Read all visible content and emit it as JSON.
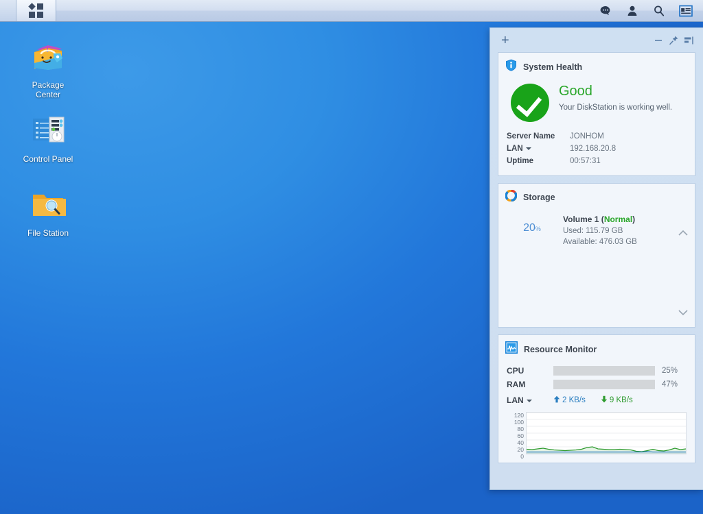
{
  "taskbar": {
    "main_menu_icon": "app-grid-icon",
    "tray": [
      {
        "name": "notifications-icon",
        "glyph": "speech-bubble"
      },
      {
        "name": "user-icon",
        "glyph": "person"
      },
      {
        "name": "search-icon",
        "glyph": "magnifier"
      },
      {
        "name": "widget-toggle-icon",
        "glyph": "widget-card"
      }
    ]
  },
  "desktop": {
    "icons": [
      {
        "name": "package-center",
        "label_line1": "Package",
        "label_line2": "Center"
      },
      {
        "name": "control-panel",
        "label_line1": "Control Panel",
        "label_line2": ""
      },
      {
        "name": "file-station",
        "label_line1": "File Station",
        "label_line2": ""
      }
    ]
  },
  "widget_panel": {
    "add_label": "+",
    "controls": [
      {
        "name": "minimize-widgets-button",
        "glyph": "minus"
      },
      {
        "name": "pin-widgets-button",
        "glyph": "pushpin"
      },
      {
        "name": "dock-widgets-button",
        "glyph": "dock-right"
      }
    ],
    "system_health": {
      "title": "System Health",
      "icon": "shield-info-icon",
      "status": "Good",
      "description": "Your DiskStation is working well.",
      "status_color": "#2aa62a",
      "rows": [
        {
          "key": "Server Name",
          "value": "JONHOM",
          "has_caret": false
        },
        {
          "key": "LAN",
          "value": "192.168.20.8",
          "has_caret": true
        },
        {
          "key": "Uptime",
          "value": "00:57:31",
          "has_caret": false
        }
      ]
    },
    "storage": {
      "title": "Storage",
      "icon": "storage-donut-icon",
      "percent": 20,
      "percent_label": "20",
      "percent_sign": "%",
      "volume_name": "Volume 1",
      "volume_status": "Normal",
      "used_label": "Used: 115.79 GB",
      "available_label": "Available: 476.03 GB",
      "arc_color": "#2a8fe0",
      "track_color": "#d6dade"
    },
    "resource_monitor": {
      "title": "Resource Monitor",
      "icon": "resource-monitor-icon",
      "bars": [
        {
          "label": "CPU",
          "percent": 25,
          "percent_label": "25%"
        },
        {
          "label": "RAM",
          "percent": 47,
          "percent_label": "47%"
        }
      ],
      "lan_label": "LAN",
      "upload_label": "2 KB/s",
      "download_label": "9 KB/s",
      "chart_data": {
        "type": "line",
        "title": "",
        "xlabel": "",
        "ylabel": "",
        "ylim": [
          0,
          120
        ],
        "yticks": [
          120,
          100,
          80,
          60,
          40,
          20,
          0
        ],
        "grid": true,
        "legend": "none",
        "x": [
          0,
          1,
          2,
          3,
          4,
          5,
          6,
          7,
          8,
          9,
          10,
          11,
          12,
          13,
          14,
          15,
          16,
          17,
          18,
          19,
          20,
          21,
          22,
          23,
          24,
          25,
          26,
          27,
          28,
          29
        ],
        "series": [
          {
            "name": "Download (KB/s)",
            "color": "#2e9b2e",
            "values": [
              13,
              12,
              14,
              16,
              13,
              11,
              10,
              9,
              10,
              11,
              13,
              18,
              20,
              14,
              13,
              12,
              12,
              13,
              12,
              11,
              7,
              6,
              9,
              13,
              9,
              8,
              11,
              16,
              12,
              14
            ]
          },
          {
            "name": "Upload (KB/s)",
            "color": "#2a7ec0",
            "values": [
              5,
              5,
              5,
              5,
              5,
              5,
              5,
              5,
              5,
              5,
              5,
              5,
              5,
              5,
              5,
              5,
              5,
              5,
              5,
              5,
              5,
              5,
              6,
              5,
              5,
              5,
              5,
              5,
              5,
              5
            ]
          }
        ]
      }
    }
  }
}
